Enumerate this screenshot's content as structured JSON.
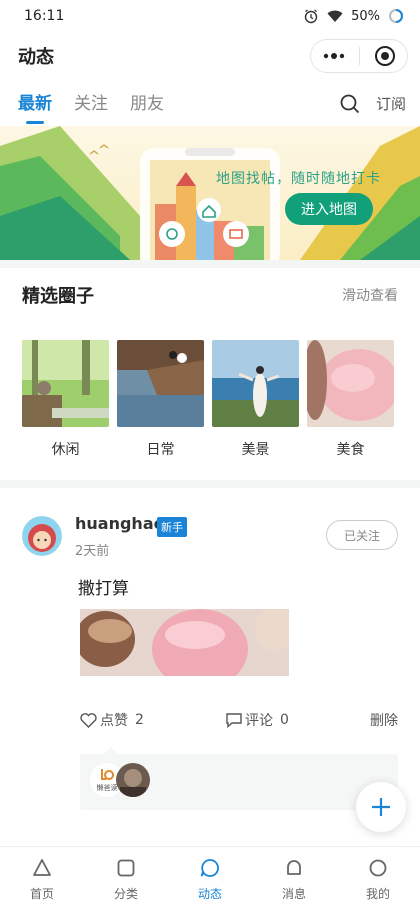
{
  "status": {
    "time": "16:11",
    "battery": "50%"
  },
  "titlebar": {
    "title": "动态"
  },
  "tabs": {
    "items": [
      "最新",
      "关注",
      "朋友"
    ],
    "active_index": 0,
    "subscribe": "订阅"
  },
  "banner": {
    "tagline": "地图找帖，随时随地打卡",
    "button": "进入地图"
  },
  "featured": {
    "title": "精选圈子",
    "more": "滑动查看",
    "circles": [
      {
        "label": "休闲"
      },
      {
        "label": "日常"
      },
      {
        "label": "美景"
      },
      {
        "label": "美食"
      }
    ]
  },
  "post": {
    "username": "huanghao",
    "badge": "新手",
    "time": "2天前",
    "follow_label": "已关注",
    "text": "撒打算",
    "like_label": "点赞",
    "like_count": "2",
    "comment_label": "评论",
    "comment_count": "0",
    "delete_label": "删除",
    "liker_logo_text": "懒爸读"
  },
  "tabbar": {
    "items": [
      {
        "label": "首页",
        "icon": "triangle-home-icon"
      },
      {
        "label": "分类",
        "icon": "square-category-icon"
      },
      {
        "label": "动态",
        "icon": "bubble-feed-icon"
      },
      {
        "label": "消息",
        "icon": "bell-message-icon"
      },
      {
        "label": "我的",
        "icon": "circle-profile-icon"
      }
    ],
    "active_index": 2
  },
  "colors": {
    "accent": "#1a85d6",
    "map_button": "#12a07b",
    "text": "#222222",
    "muted": "#888888"
  }
}
